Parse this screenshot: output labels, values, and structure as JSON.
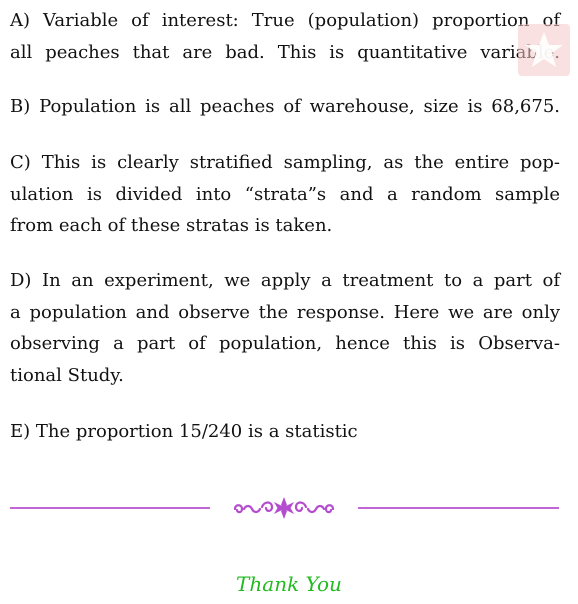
{
  "answers": [
    {
      "lines": [
        "A) Variable of interest: True (population) proportion of",
        "all peaches that are bad. This is quantitative variable."
      ]
    },
    {
      "lines": [
        "B) Population is all peaches of warehouse, size is 68,675."
      ]
    },
    {
      "lines": [
        "C) This is clearly stratified sampling, as the entire pop-",
        "ulation is divided into “strata”s and a random sample",
        "from each of these stratas is taken."
      ]
    },
    {
      "lines": [
        "D) In an experiment, we apply a treatment to a part of",
        "a population and observe the response. Here we are only",
        "observing a part of population, hence this is Observa-",
        "tional Study."
      ]
    },
    {
      "lines": [
        "E) The proportion 15/240 is a statistic"
      ]
    }
  ],
  "closing": {
    "thank_you": "Thank You"
  },
  "colors": {
    "ornament": "#b44ccf",
    "thank_you": "#22bb22",
    "watermark": "#f6c9c9"
  }
}
